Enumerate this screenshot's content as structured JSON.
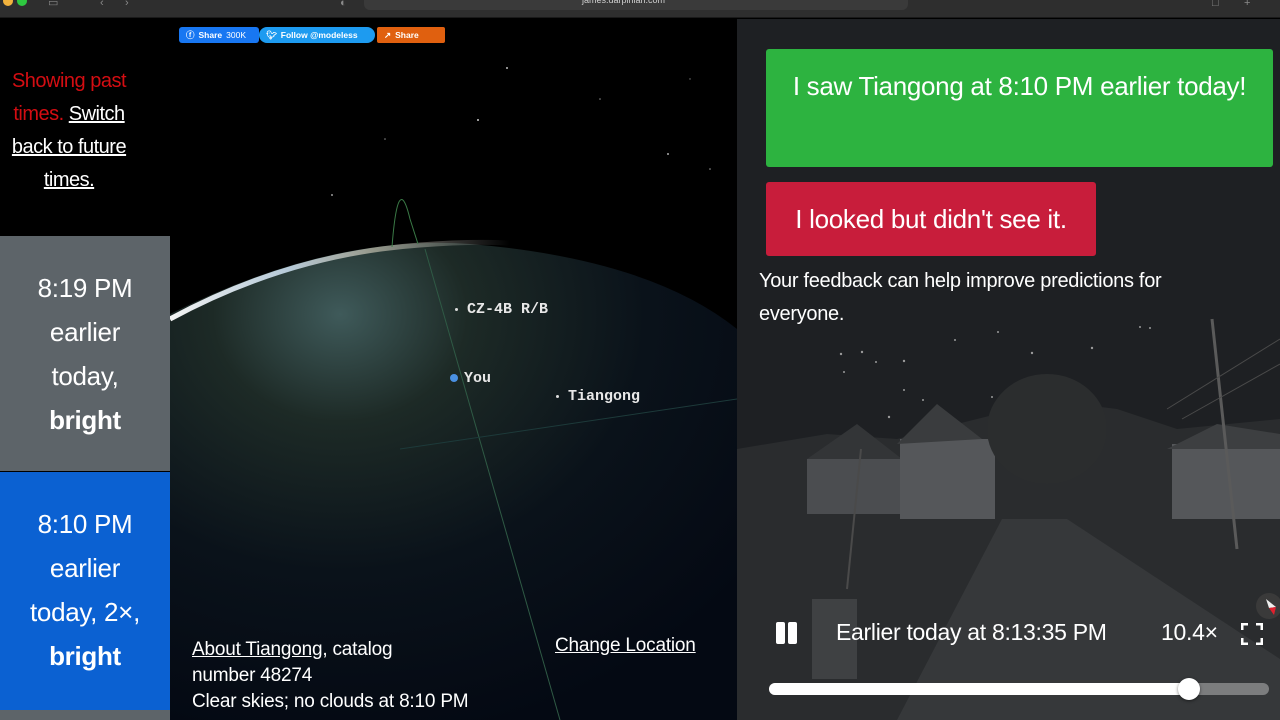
{
  "browser": {
    "url": "james.darpinian.com"
  },
  "sidebar": {
    "notice_prefix": "Showing past times.",
    "notice_link": "Switch back to future times.",
    "passes": [
      {
        "time": "8:19 PM",
        "line2": "earlier",
        "line3": "today,",
        "brightness": "bright",
        "selected": false
      },
      {
        "time": "8:10 PM",
        "line2": "earlier",
        "line3": "today, 2×,",
        "brightness": "bright",
        "selected": true
      }
    ]
  },
  "share": {
    "facebook_label": "Share",
    "facebook_count": "300K",
    "twitter_label": "Follow @modeless",
    "share_label": "Share"
  },
  "globe": {
    "labels": {
      "rocket_body": "CZ-4B R/B",
      "you": "You",
      "satellite": "Tiangong"
    },
    "about_link": "About Tiangong",
    "catalog_text": ", catalog number 48274",
    "weather_text": "Clear skies; no clouds at 8:10 PM",
    "change_location": "Change Location"
  },
  "feedback": {
    "saw_button": "I saw Tiangong at 8:10 PM earlier today!",
    "not_seen_button": "I looked but didn't see it.",
    "note": "Your feedback can help improve predictions for everyone.",
    "colors": {
      "saw": "#2db340",
      "not_seen": "#c81d3b"
    }
  },
  "playback": {
    "state": "playing",
    "time_readout": "Earlier today at 8:13:35 PM",
    "speed": "10.4×",
    "progress": 0.84
  },
  "colors": {
    "selected_pass": "#0b61d2",
    "unselected_pass": "#5d6469",
    "notice_red": "#d40d12"
  }
}
